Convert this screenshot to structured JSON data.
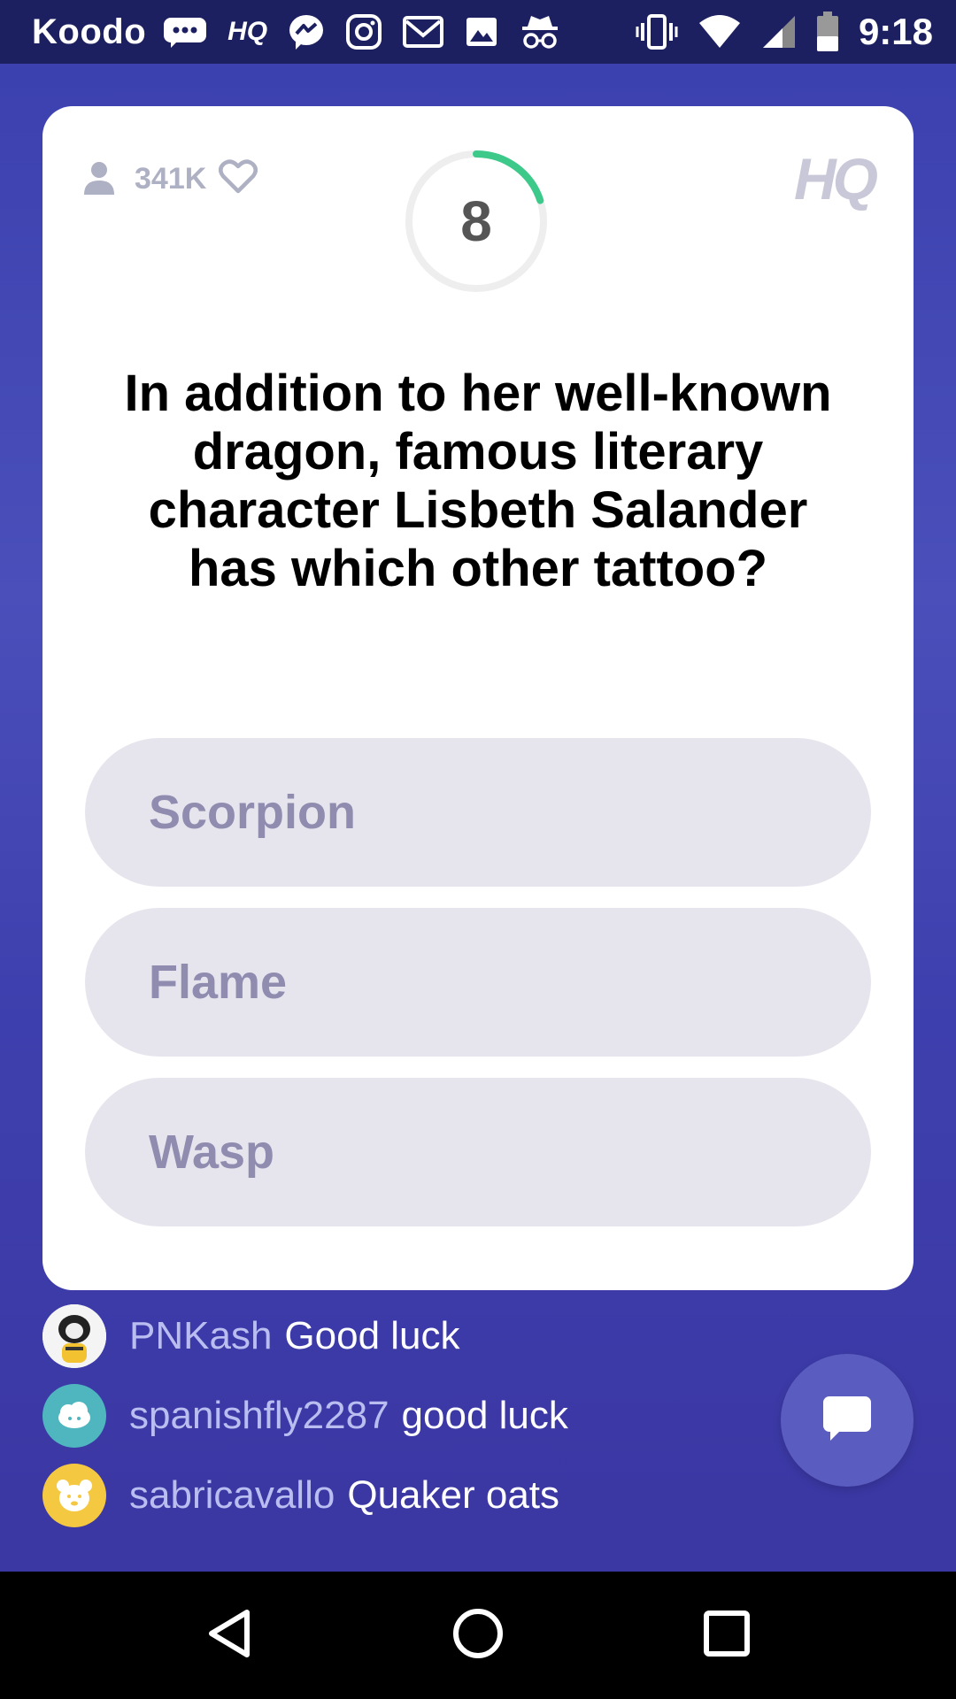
{
  "status_bar": {
    "carrier": "Koodo",
    "hq_label": "HQ",
    "time": "9:18",
    "icons": [
      "chat-bubble-icon",
      "hq-icon",
      "messenger-icon",
      "instagram-icon",
      "gmail-icon",
      "image-icon",
      "incognito-icon",
      "vibrate-icon",
      "wifi-icon",
      "signal-icon",
      "battery-icon"
    ]
  },
  "game": {
    "viewer_count": "341K",
    "timer": "8",
    "timer_progress": 0.2,
    "logo": "HQ",
    "question": "In addition to her well-known dragon, famous literary character Lisbeth Salander has which other tattoo?",
    "answers": [
      "Scorpion",
      "Flame",
      "Wasp"
    ]
  },
  "chat": {
    "messages": [
      {
        "user": "PNKash",
        "text": "Good luck",
        "avatar": "photo"
      },
      {
        "user": "spanishfly2287",
        "text": "good luck",
        "avatar": "cloud-avatar"
      },
      {
        "user": "sabricavallo",
        "text": "Quaker oats",
        "avatar": "bear-avatar"
      }
    ]
  },
  "colors": {
    "accent_green": "#3cc98a",
    "answer_bg": "#e6e5ee",
    "answer_text": "#8f8cb0",
    "chat_button": "#5a5cc0"
  }
}
